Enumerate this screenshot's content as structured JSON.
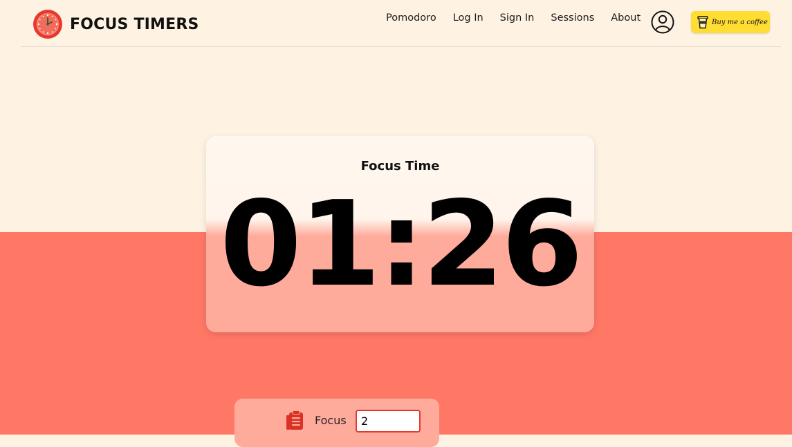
{
  "brand": {
    "title": "FOCUS TIMERS"
  },
  "nav": {
    "items": [
      "Pomodoro",
      "Log In",
      "Sign In",
      "Sessions",
      "About"
    ]
  },
  "coffee": {
    "label": "Buy me a coffee"
  },
  "timer": {
    "label": "Focus Time",
    "value": "01:26"
  },
  "settings": {
    "focus_label": "Focus",
    "focus_value": "2"
  },
  "colors": {
    "background_top": "#FEF3E2",
    "background_bottom": "#FF7866",
    "accent_red": "#E23B2E",
    "coffee_yellow": "#FFDD33"
  }
}
